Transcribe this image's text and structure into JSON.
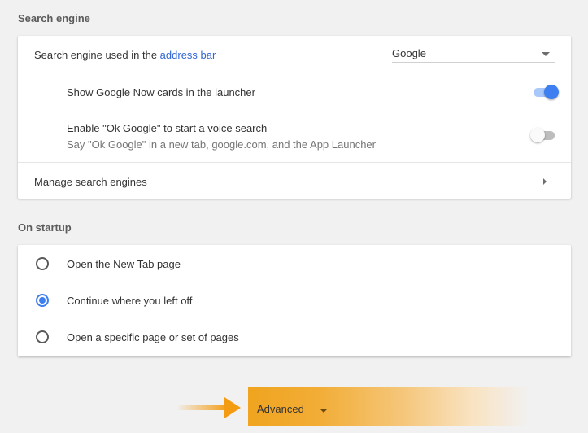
{
  "search_engine_section": {
    "title": "Search engine",
    "engine_row": {
      "label_prefix": "Search engine used in the ",
      "label_link": "address bar",
      "selected": "Google"
    },
    "google_now_row": {
      "label": "Show Google Now cards in the launcher",
      "toggle_state": "on"
    },
    "ok_google_row": {
      "label": "Enable \"Ok Google\" to start a voice search",
      "sublabel": "Say \"Ok Google\" in a new tab, google.com, and the App Launcher",
      "toggle_state": "off"
    },
    "manage_row": {
      "label": "Manage search engines"
    }
  },
  "startup_section": {
    "title": "On startup",
    "options": [
      {
        "label": "Open the New Tab page",
        "checked": false
      },
      {
        "label": "Continue where you left off",
        "checked": true
      },
      {
        "label": "Open a specific page or set of pages",
        "checked": false
      }
    ]
  },
  "advanced": {
    "label": "Advanced"
  },
  "colors": {
    "accent": "#3d7ef0",
    "link": "#3367d6",
    "highlight": "#f39c12"
  }
}
